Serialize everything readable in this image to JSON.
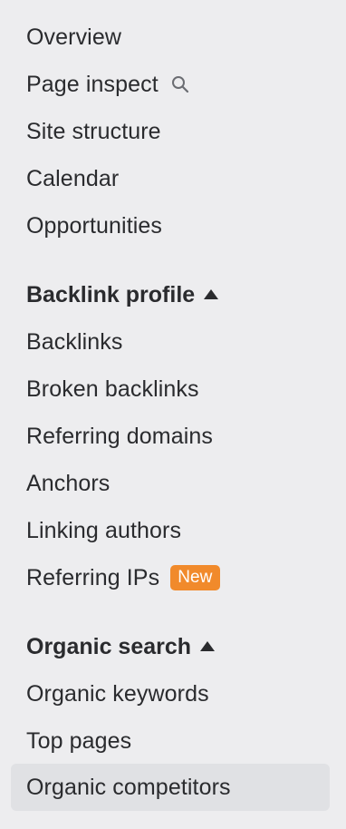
{
  "nav": {
    "items_top": [
      {
        "label": "Overview"
      },
      {
        "label": "Page inspect",
        "icon": "search-icon"
      },
      {
        "label": "Site structure"
      },
      {
        "label": "Calendar"
      },
      {
        "label": "Opportunities"
      }
    ],
    "backlink_profile": {
      "heading": "Backlink profile",
      "caret": "caret-up-icon",
      "items": [
        {
          "label": "Backlinks"
        },
        {
          "label": "Broken backlinks"
        },
        {
          "label": "Referring domains"
        },
        {
          "label": "Anchors"
        },
        {
          "label": "Linking authors"
        },
        {
          "label": "Referring IPs",
          "badge": "New"
        }
      ]
    },
    "organic_search": {
      "heading": "Organic search",
      "caret": "caret-up-icon",
      "items": [
        {
          "label": "Organic keywords"
        },
        {
          "label": "Top pages"
        },
        {
          "label": "Organic competitors",
          "selected": true
        }
      ]
    }
  },
  "colors": {
    "background": "#ededef",
    "text": "#2a2b2e",
    "selected_bg": "#e0e1e4",
    "badge_bg": "#f18a2b",
    "badge_text": "#ffffff"
  }
}
